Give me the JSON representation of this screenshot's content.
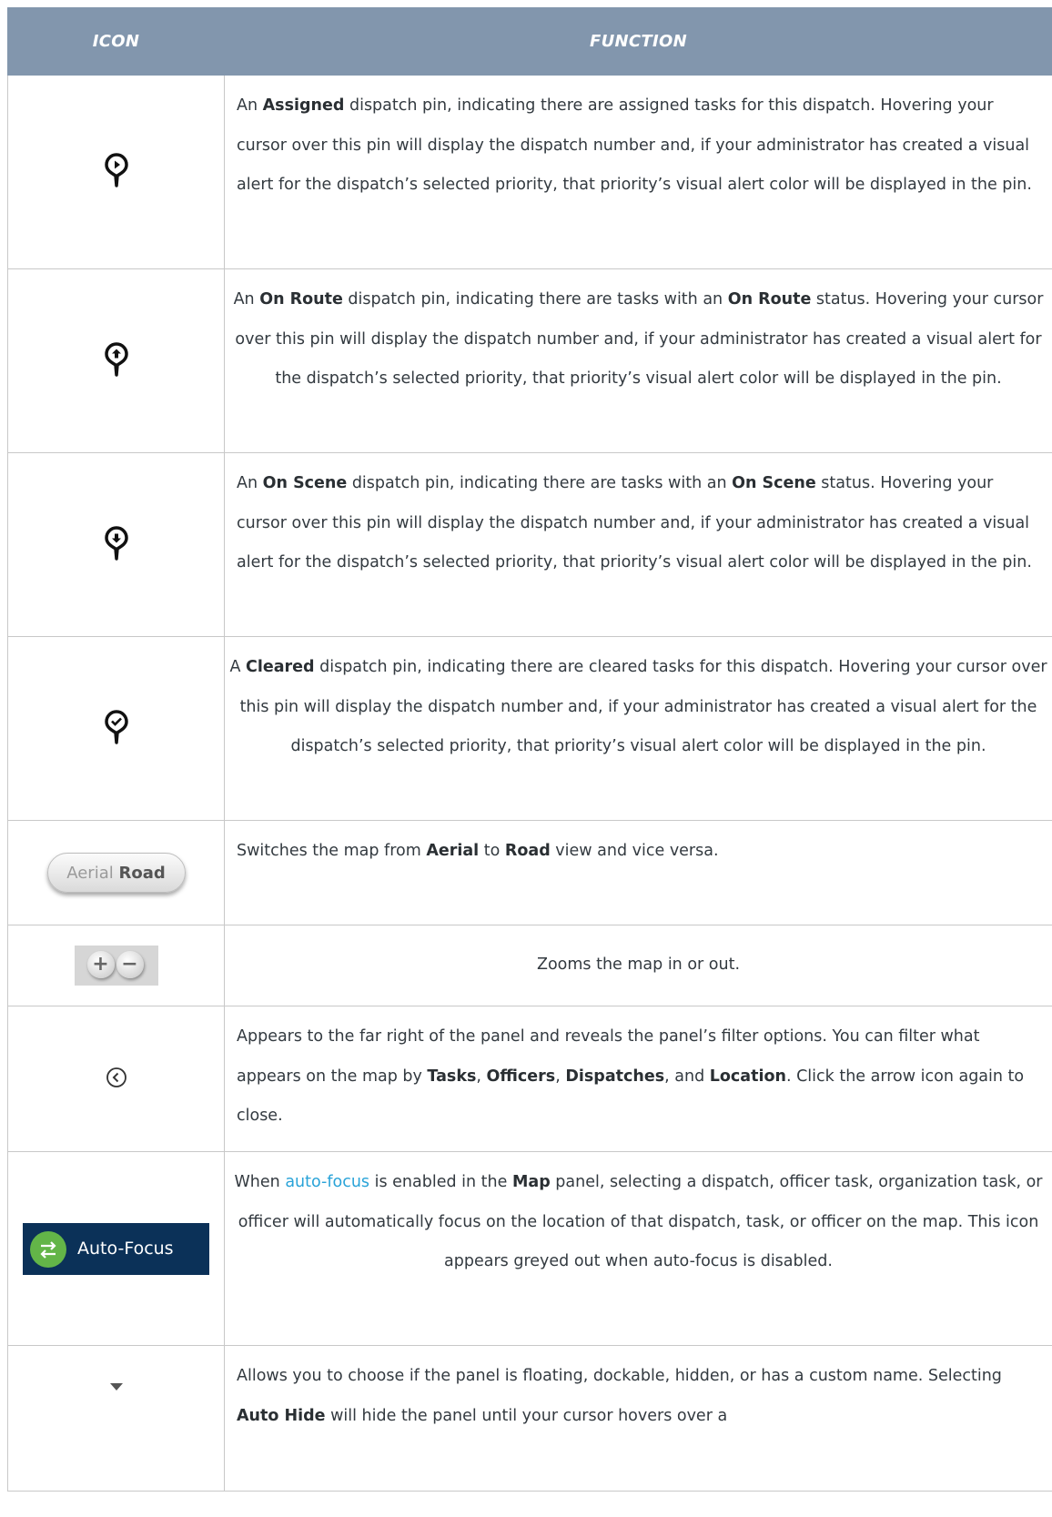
{
  "header": {
    "col_icon": "ICON",
    "col_function": "FUNCTION"
  },
  "rows": [
    {
      "icon": "assigned-pin-icon",
      "parts": [
        {
          "t": "An "
        },
        {
          "b": "Assigned"
        },
        {
          "t": " dispatch pin, indicating there are assigned tasks for this dispatch. Hovering your cursor over this pin will display the dispatch number and, if your administrator has created a visual alert for the dispatch’s selected priority, that priority’s visual alert color will be displayed in the pin."
        }
      ]
    },
    {
      "icon": "on-route-pin-icon",
      "parts": [
        {
          "t": "An "
        },
        {
          "b": "On Route"
        },
        {
          "t": " dispatch pin, indicating there are tasks with an "
        },
        {
          "b": "On Route"
        },
        {
          "t": " status. Hovering your cursor over this pin will display the dispatch number and, if your administrator has created a visual alert for the dispatch’s selected priority, that priority’s visual alert color will be displayed in the pin."
        }
      ]
    },
    {
      "icon": "on-scene-pin-icon",
      "parts": [
        {
          "t": "An "
        },
        {
          "b": "On Scene"
        },
        {
          "t": " dispatch pin, indicating there are tasks with an "
        },
        {
          "b": "On Scene"
        },
        {
          "t": " status. Hovering your cursor over this pin will display the dispatch number and, if your administrator has created a visual alert for the dispatch’s selected priority, that priority’s visual alert color will be displayed in the pin."
        }
      ]
    },
    {
      "icon": "cleared-pin-icon",
      "parts": [
        {
          "t": "A "
        },
        {
          "b": "Cleared"
        },
        {
          "t": " dispatch pin, indicating there are cleared tasks for this dispatch. Hovering your cursor over this pin will display the dispatch number and, if your administrator has created a visual alert for the dispatch’s selected priority, that priority’s visual alert color will be displayed in the pin."
        }
      ]
    },
    {
      "icon": "aerial-road-toggle-icon",
      "icon_text": {
        "aerial": "Aerial",
        "road": "Road"
      },
      "parts": [
        {
          "t": "Switches the map from "
        },
        {
          "b": "Aerial"
        },
        {
          "t": " to "
        },
        {
          "b": "Road"
        },
        {
          "t": " view and vice versa."
        }
      ]
    },
    {
      "icon": "zoom-in-out-icon",
      "icon_text": {
        "plus": "+",
        "minus": "−"
      },
      "parts": [
        {
          "t": "Zooms the map in or out."
        }
      ]
    },
    {
      "icon": "chevron-left-circle-icon",
      "parts": [
        {
          "t": "Appears to the far right of the panel and reveals the panel’s filter options. You can filter what appears on the map by "
        },
        {
          "b": "Tasks"
        },
        {
          "t": ", "
        },
        {
          "b": "Officers"
        },
        {
          "t": ", "
        },
        {
          "b": "Dispatches"
        },
        {
          "t": ", and "
        },
        {
          "b": "Location"
        },
        {
          "t": ". Click the arrow icon again to close."
        }
      ]
    },
    {
      "icon": "auto-focus-icon",
      "icon_text": {
        "label": "Auto-Focus"
      },
      "parts": [
        {
          "t": "When "
        },
        {
          "link": "auto-focus"
        },
        {
          "t": " is enabled in the "
        },
        {
          "b": "Map"
        },
        {
          "t": " panel, selecting a dispatch, officer task, organization task, or officer will automatically focus on the location of that dispatch, task, or officer on the map. This icon appears greyed out when auto-focus is disabled."
        }
      ]
    },
    {
      "icon": "dropdown-caret-icon",
      "parts": [
        {
          "t": "Allows you to choose if the panel is floating, dockable, hidden, or has a custom name. Selecting "
        },
        {
          "b": "Auto Hide"
        },
        {
          "t": " will hide the panel until your cursor hovers over a"
        }
      ]
    }
  ]
}
